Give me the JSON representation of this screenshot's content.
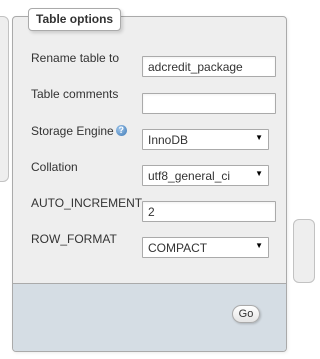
{
  "fieldset": {
    "legend": "Table options"
  },
  "rows": {
    "rename": {
      "label": "Rename table to",
      "value": "adcredit_package"
    },
    "comments": {
      "label": "Table comments",
      "value": ""
    },
    "storage_engine": {
      "label": "Storage Engine",
      "value": "InnoDB",
      "icon": "help-icon"
    },
    "collation": {
      "label": "Collation",
      "value": "utf8_general_ci"
    },
    "auto_increment": {
      "label": "AUTO_INCREMENT",
      "value": "2"
    },
    "row_format": {
      "label": "ROW_FORMAT",
      "value": "COMPACT"
    }
  },
  "actions": {
    "go_label": "Go"
  },
  "colors": {
    "fieldset_bg": "#eeeeee",
    "footer_bg": "#d5dde4",
    "border": "#aaaaaa"
  }
}
